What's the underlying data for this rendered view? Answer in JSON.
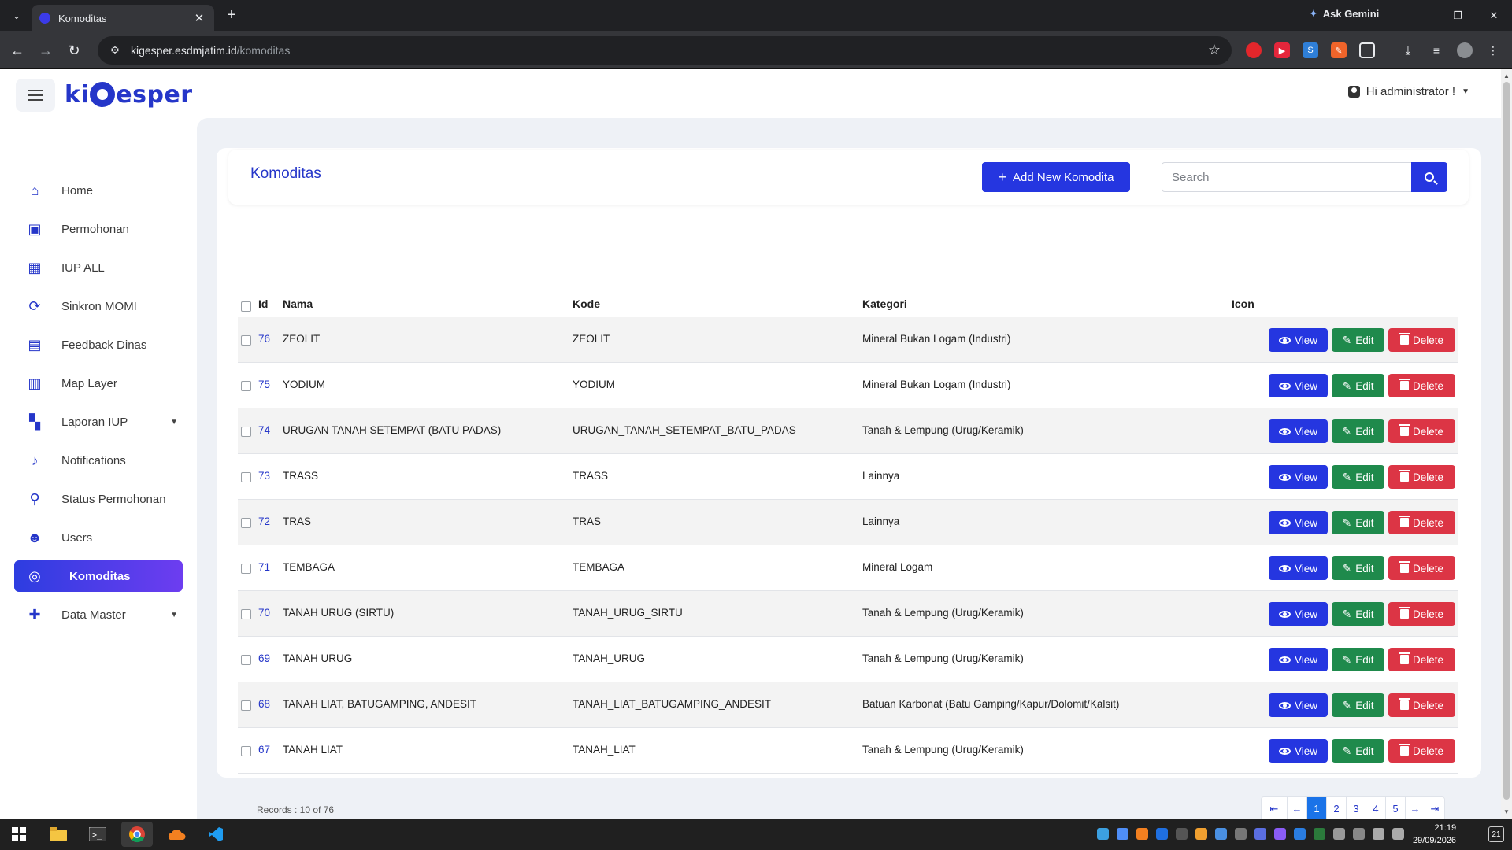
{
  "browser": {
    "tab_title": "Komoditas",
    "tab_close": "✕",
    "new_tab": "+",
    "ask_gemini": "Ask Gemini",
    "url_host": "kigesper.esdmjatim.id",
    "url_path": "/komoditas"
  },
  "header": {
    "logo_left": "ki",
    "logo_right": "esper",
    "user_greeting": "Hi administrator !"
  },
  "sidebar": {
    "items": [
      {
        "label": "Home"
      },
      {
        "label": "Permohonan"
      },
      {
        "label": "IUP ALL"
      },
      {
        "label": "Sinkron MOMI"
      },
      {
        "label": "Feedback Dinas"
      },
      {
        "label": "Map Layer"
      },
      {
        "label": "Laporan IUP"
      },
      {
        "label": "Notifications"
      },
      {
        "label": "Status Permohonan"
      },
      {
        "label": "Users"
      },
      {
        "label": "Komoditas"
      },
      {
        "label": "Data Master"
      }
    ]
  },
  "main": {
    "title": "Komoditas",
    "add_button": "Add New Komodita",
    "search_placeholder": "Search",
    "columns": {
      "id": "Id",
      "nama": "Nama",
      "kode": "Kode",
      "kategori": "Kategori",
      "icon": "Icon"
    },
    "actions": {
      "view": "View",
      "edit": "Edit",
      "delete": "Delete"
    },
    "rows": [
      {
        "id": "76",
        "nama": "ZEOLIT",
        "kode": "ZEOLIT",
        "kategori": "Mineral Bukan Logam (Industri)"
      },
      {
        "id": "75",
        "nama": "YODIUM",
        "kode": "YODIUM",
        "kategori": "Mineral Bukan Logam (Industri)"
      },
      {
        "id": "74",
        "nama": "URUGAN TANAH SETEMPAT (BATU PADAS)",
        "kode": "URUGAN_TANAH_SETEMPAT_BATU_PADAS",
        "kategori": "Tanah & Lempung (Urug/Keramik)"
      },
      {
        "id": "73",
        "nama": "TRASS",
        "kode": "TRASS",
        "kategori": "Lainnya"
      },
      {
        "id": "72",
        "nama": "TRAS",
        "kode": "TRAS",
        "kategori": "Lainnya"
      },
      {
        "id": "71",
        "nama": "TEMBAGA",
        "kode": "TEMBAGA",
        "kategori": "Mineral Logam"
      },
      {
        "id": "70",
        "nama": "TANAH URUG (SIRTU)",
        "kode": "TANAH_URUG_SIRTU",
        "kategori": "Tanah & Lempung (Urug/Keramik)"
      },
      {
        "id": "69",
        "nama": "TANAH URUG",
        "kode": "TANAH_URUG",
        "kategori": "Tanah & Lempung (Urug/Keramik)"
      },
      {
        "id": "68",
        "nama": "TANAH LIAT, BATUGAMPING, ANDESIT",
        "kode": "TANAH_LIAT_BATUGAMPING_ANDESIT",
        "kategori": "Batuan Karbonat (Batu Gamping/Kapur/Dolomit/Kalsit)"
      },
      {
        "id": "67",
        "nama": "TANAH LIAT",
        "kode": "TANAH_LIAT",
        "kategori": "Tanah & Lempung (Urug/Keramik)"
      }
    ],
    "records_text": "Records : 10 of 76",
    "pagination": {
      "first": "⇤",
      "prev": "←",
      "pages": [
        "1",
        "2",
        "3",
        "4",
        "5"
      ],
      "next": "→",
      "last": "⇥",
      "current_page": "1"
    }
  },
  "taskbar": {
    "time": "21:19",
    "date": "29/09/2026",
    "notification_count": "21"
  },
  "colors": {
    "primary": "#2536e0",
    "success": "#1f8a4c",
    "danger": "#dc3545",
    "active_page": "#1a73e8"
  }
}
